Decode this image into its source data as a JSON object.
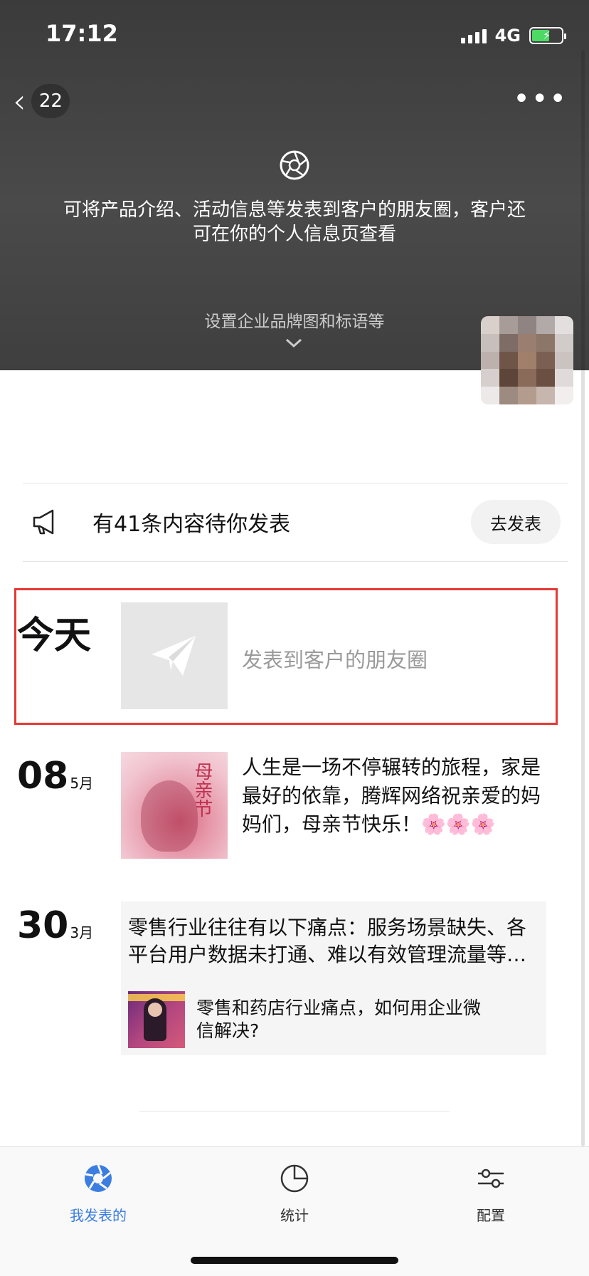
{
  "status_bar": {
    "time": "17:12",
    "network": "4G"
  },
  "nav": {
    "back_count": "22"
  },
  "header": {
    "intro_text": "可将产品介绍、活动信息等发表到客户的朋友圈，客户还可在你的个人信息页查看",
    "brand_setting_label": "设置企业品牌图和标语等"
  },
  "pending": {
    "text": "有41条内容待你发表",
    "button_label": "去发表"
  },
  "today": {
    "date_label": "今天",
    "prompt": "发表到客户的朋友圈"
  },
  "posts": [
    {
      "day": "08",
      "month": "5月",
      "text": "人生是一场不停辗转的旅程，家是最好的依靠，腾辉网络祝亲爱的妈妈们，母亲节快乐！🌸🌸🌸",
      "thumb_title": "母亲节"
    },
    {
      "day": "30",
      "month": "3月",
      "text": "零售行业往往有以下痛点：服务场景缺失、各平台用户数据未打通、难以有效管理流量等问题。",
      "link_title": "零售和药店行业痛点，如何用企业微信解决?"
    }
  ],
  "tabs": [
    {
      "label": "我发表的",
      "icon": "aperture-icon",
      "active": true
    },
    {
      "label": "统计",
      "icon": "pie-chart-icon",
      "active": false
    },
    {
      "label": "配置",
      "icon": "sliders-icon",
      "active": false
    }
  ],
  "colors": {
    "active_tab": "#3b7de0",
    "highlight_border": "#e53935",
    "header_bg": "#3f3f3f"
  }
}
